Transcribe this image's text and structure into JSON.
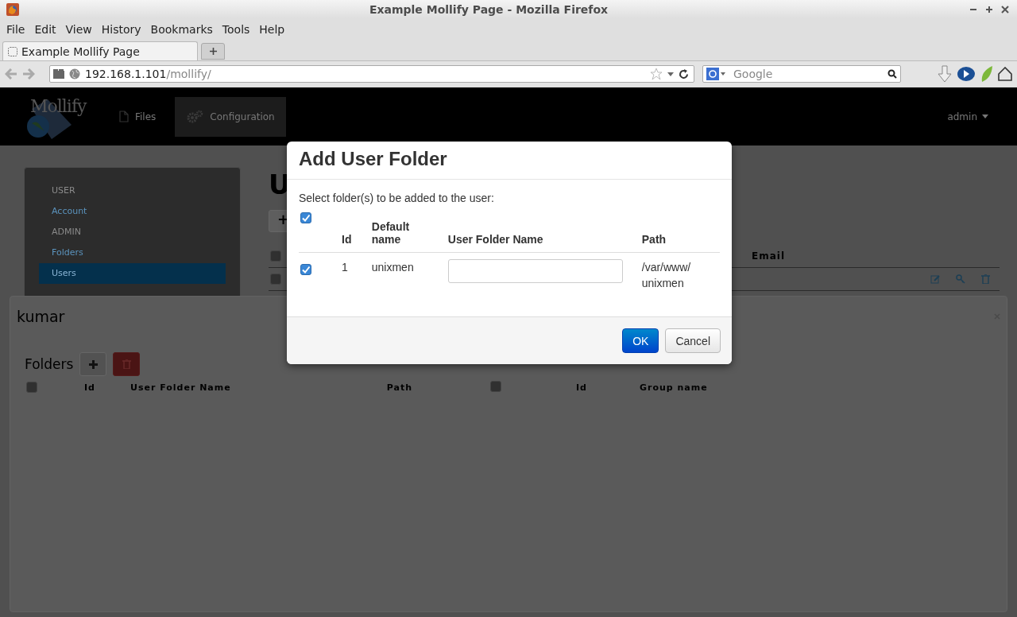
{
  "window": {
    "title": "Example Mollify Page - Mozilla Firefox"
  },
  "menu": [
    "File",
    "Edit",
    "View",
    "History",
    "Bookmarks",
    "Tools",
    "Help"
  ],
  "tabs": [
    {
      "label": "Example Mollify Page",
      "selected": true
    }
  ],
  "address": {
    "host": "192.168.1.101",
    "path": "/mollify/"
  },
  "search": {
    "placeholder": "Google"
  },
  "app": {
    "logo": "Mollify",
    "nav": [
      {
        "label": "Files",
        "kind": "file",
        "selected": false
      },
      {
        "label": "Configuration",
        "kind": "gear",
        "selected": true
      }
    ],
    "user_menu": "admin",
    "sidebar": [
      {
        "label": "USER",
        "kind": "header",
        "selected": false
      },
      {
        "label": "Account",
        "kind": "link",
        "selected": false
      },
      {
        "label": "ADMIN",
        "kind": "header",
        "selected": false
      },
      {
        "label": "Folders",
        "kind": "link",
        "selected": false
      },
      {
        "label": "Users",
        "kind": "link",
        "selected": true
      }
    ],
    "main": {
      "title": "U",
      "add_button": "+",
      "table": {
        "header_checked": false,
        "column": "Email",
        "rows": [
          {
            "checked": false
          }
        ]
      }
    },
    "user_panel": {
      "title": "kumar",
      "section": "Folders",
      "header_checked": false,
      "columns": [
        "Id",
        "User Folder Name",
        "Path"
      ],
      "group_header_checked": false,
      "group_columns": [
        "Id",
        "Group name"
      ]
    }
  },
  "modal": {
    "title": "Add User Folder",
    "instruction": "Select folder(s) to be added to the user:",
    "header_checked": true,
    "columns": [
      "Id",
      "Default name",
      "User Folder Name",
      "Path"
    ],
    "rows": [
      {
        "checked": true,
        "id": "1",
        "default_name": "unixmen",
        "path": "/var/www/unixmen"
      }
    ],
    "buttons": [
      {
        "label": "OK",
        "kind": "primary"
      },
      {
        "label": "Cancel",
        "kind": "default"
      }
    ]
  }
}
